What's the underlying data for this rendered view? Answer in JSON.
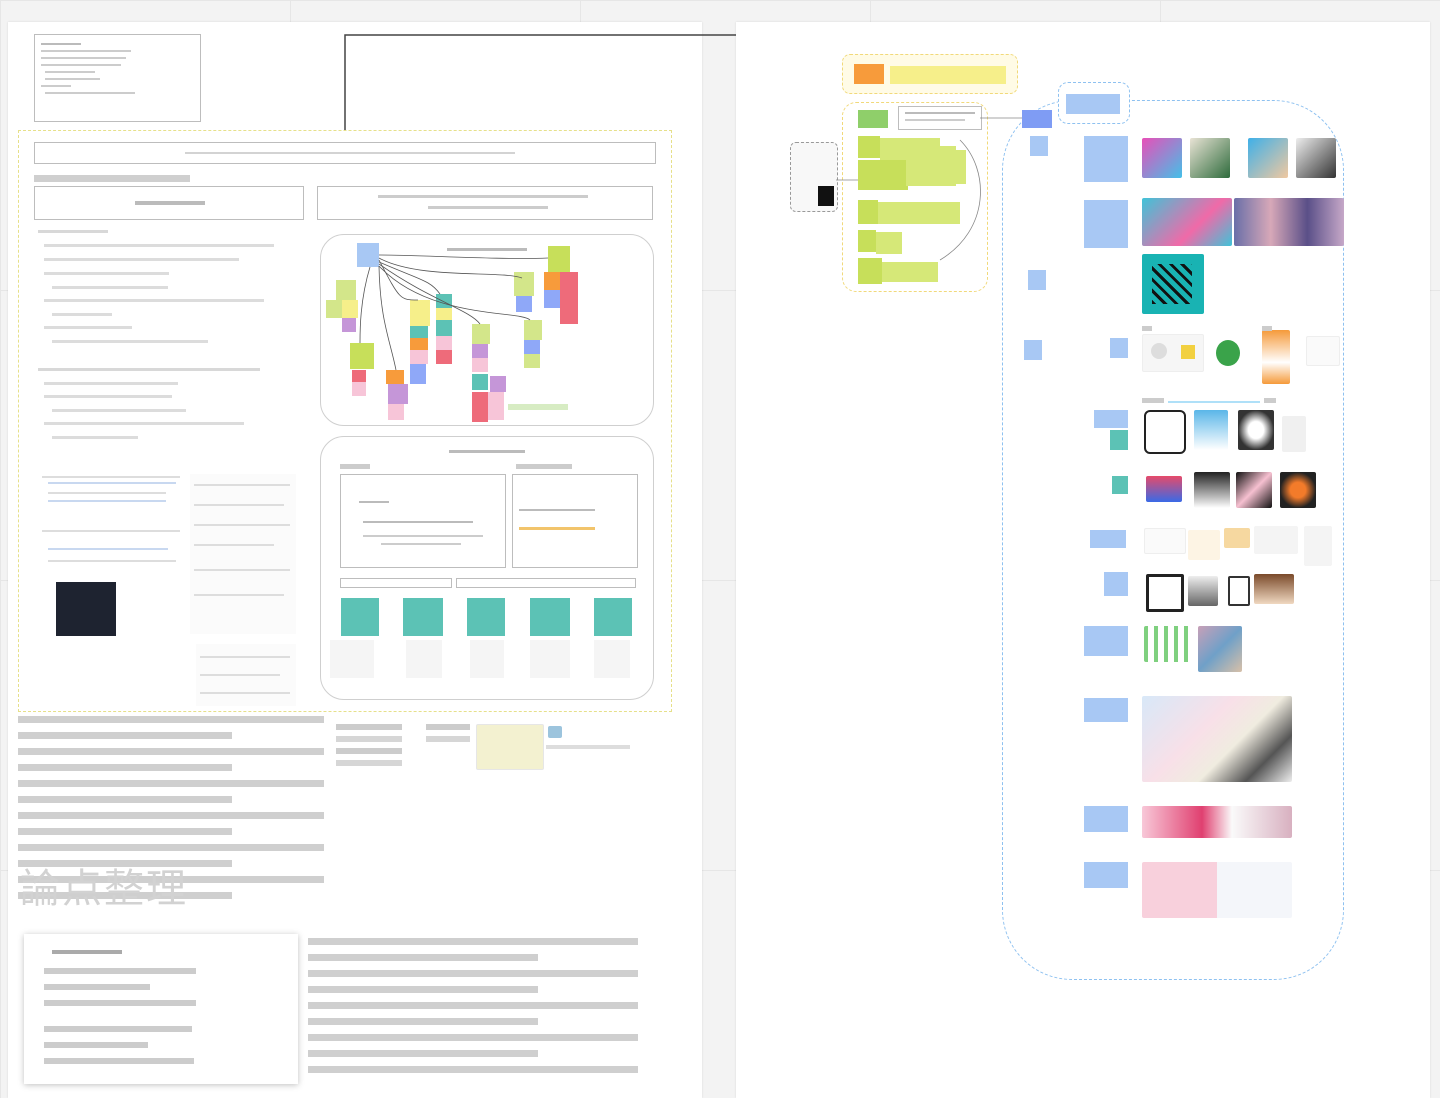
{
  "board": {
    "left_frame": {
      "memo_text": "",
      "banner_text": "",
      "heading_left": "",
      "heading_right": "",
      "bullets": [
        "",
        "",
        "",
        "",
        "",
        "",
        "",
        "",
        "",
        "",
        "",
        "",
        "",
        "",
        "",
        ""
      ],
      "shared_space_label": "",
      "personal_space_label": "",
      "watermark_title": "論点整理",
      "summary_card_title": ""
    },
    "right_frame": {
      "group_label": ""
    }
  },
  "colors": {
    "frame_dashed_yellow": "#e6e08a",
    "dashed_blue": "#8ec1f0",
    "sticky_blue": "#a8c8f4",
    "sticky_green": "#c7df5a",
    "sticky_teal": "#5cc2b5",
    "sticky_orange": "#f79b3b",
    "sticky_red": "#ee6b7a",
    "sticky_pink": "#f7c5d8",
    "sticky_purple": "#c596d8",
    "sticky_yellow": "#f6ef8a"
  },
  "icons": [
    "connector-line",
    "image-thumbnail",
    "sticky-note"
  ]
}
